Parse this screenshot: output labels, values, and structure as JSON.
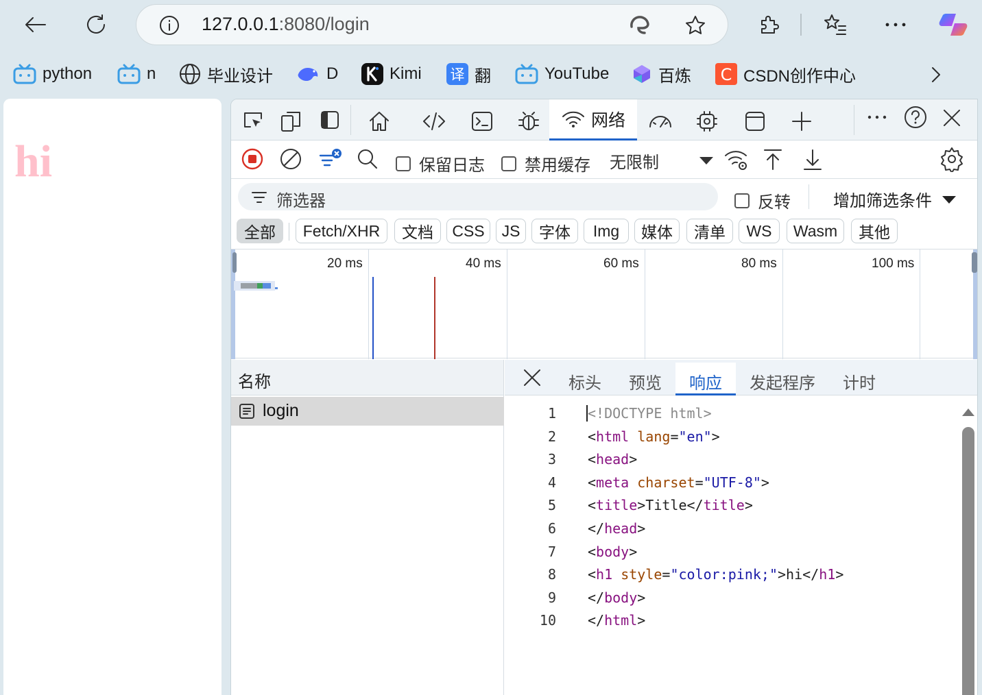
{
  "browser": {
    "url_host": "127.0.0.1",
    "url_rest": ":8080/login",
    "bookmarks": [
      {
        "label": "python",
        "icon": "bilibili-icon"
      },
      {
        "label": "n",
        "icon": "bilibili-icon"
      },
      {
        "label": "毕业设计",
        "icon": "globe-icon"
      },
      {
        "label": "D",
        "icon": "deepseek-icon"
      },
      {
        "label": "Kimi",
        "icon": "kimi-icon"
      },
      {
        "label": "翻",
        "icon": "translate-icon"
      },
      {
        "label": "YouTube",
        "icon": "bilibili-icon"
      },
      {
        "label": "百炼",
        "icon": "bailian-icon"
      },
      {
        "label": "CSDN创作中心",
        "icon": "csdn-icon"
      }
    ]
  },
  "page": {
    "heading": "hi",
    "heading_color": "#ffc0cb"
  },
  "devtools": {
    "active_tab": "网络",
    "toolbar": {
      "preserve_log": "保留日志",
      "disable_cache": "禁用缓存",
      "throttling": "无限制"
    },
    "filter": {
      "placeholder": "筛选器",
      "invert": "反转",
      "more_filters": "增加筛选条件"
    },
    "type_filters": [
      "全部",
      "Fetch/XHR",
      "文档",
      "CSS",
      "JS",
      "字体",
      "Img",
      "媒体",
      "清单",
      "WS",
      "Wasm",
      "其他"
    ],
    "timeline_ticks": [
      "20 ms",
      "40 ms",
      "60 ms",
      "80 ms",
      "100 ms"
    ],
    "requests": {
      "column_name": "名称",
      "rows": [
        {
          "name": "login"
        }
      ]
    },
    "detail_tabs": [
      "标头",
      "预览",
      "响应",
      "发起程序",
      "计时"
    ],
    "active_detail_tab": "响应",
    "response_line_numbers": [
      "1",
      "2",
      "3",
      "4",
      "5",
      "6",
      "7",
      "8",
      "9",
      "10"
    ],
    "response_lines": [
      "<!DOCTYPE html>",
      "<html lang=\"en\">",
      "<head>",
      "<meta charset=\"UTF-8\">",
      "<title>Title</title>",
      "</head>",
      "<body>",
      "<h1 style=\"color:pink;\">hi</h1>",
      "</body>",
      "</html>"
    ]
  },
  "colors": {
    "accent": "#1f63c9",
    "record": "#d93025",
    "dom_content_loaded_line": "#2451c7",
    "load_line": "#b0352a"
  }
}
